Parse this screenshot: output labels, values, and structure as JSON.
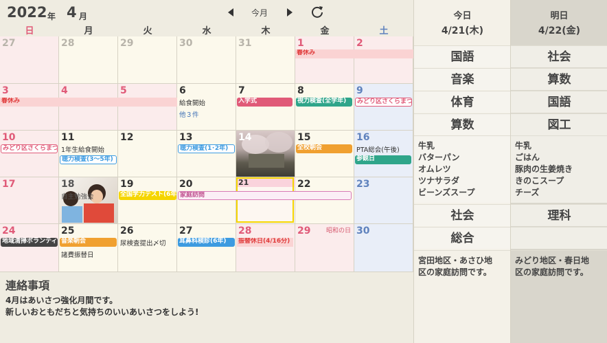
{
  "header": {
    "year": "2022",
    "year_unit": "年",
    "month": "4",
    "month_unit": "月",
    "today_button": "今月",
    "weekdays": [
      "日",
      "月",
      "火",
      "水",
      "木",
      "金",
      "土"
    ]
  },
  "days": {
    "r0": [
      "27",
      "28",
      "29",
      "30",
      "31",
      "1",
      "2"
    ],
    "r1": [
      "3",
      "4",
      "5",
      "6",
      "7",
      "8",
      "9"
    ],
    "r2": [
      "10",
      "11",
      "12",
      "13",
      "14",
      "15",
      "16"
    ],
    "r3": [
      "17",
      "18",
      "19",
      "20",
      "21",
      "22",
      "23"
    ],
    "r4": [
      "24",
      "25",
      "26",
      "27",
      "28",
      "29",
      "30"
    ]
  },
  "events": {
    "haruyasumi_1": "春休み",
    "haruyasumi_2": "春休み",
    "kyushoku_start": "給食開始",
    "more_count": "他３件",
    "nyugakushiki": "入学式",
    "shiryoku": "視力検査(全学年)",
    "midori_1": "みどり区さくらまつり",
    "midori_2": "みどり区さくらまつり",
    "kyushoku_1nen": "1年生給食開始",
    "choryoku_1": "聴力検査(3〜5年)",
    "choryoku_2": "聴力検査(1･2年)",
    "zenko_chokai": "全校朝会",
    "pta": "PTA総会(午後)",
    "sankanbi": "参観日",
    "jishu_kyugyo": "自主勉強会",
    "zenkoku_test": "全国学力テスト(6年)",
    "katei_homon": "家庭訪問",
    "chiiki_seiso": "地域清掃ボランティア",
    "ongaku_chokai": "音楽朝会",
    "shohi_furikae": "諸費振替日",
    "nyo_kensa": "尿検査提出〆切",
    "jibika": "耳鼻科検診(6年)",
    "furikae_kyujitsu": "振替休日(4/16分)",
    "showa_no_hi": "昭和の日"
  },
  "notes": {
    "title": "連絡事項",
    "line1": "4月はあいさつ強化月間です。",
    "line2": "新しいおともだちと気持ちのいいあいさつをしよう!"
  },
  "today": {
    "label": "今日",
    "date": "4/21(木)",
    "subjects1": [
      "国語",
      "音楽",
      "体育",
      "算数"
    ],
    "lunch": [
      "牛乳",
      "バターパン",
      "オムレツ",
      "ツナサラダ",
      "ビーンズスープ"
    ],
    "subjects2": [
      "社会",
      "総合"
    ],
    "notice_line1": "宮田地区・あさひ地",
    "notice_line2": "区の家庭訪問です。"
  },
  "tomorrow": {
    "label": "明日",
    "date": "4/22(金)",
    "subjects1": [
      "社会",
      "算数",
      "国語",
      "図工"
    ],
    "lunch": [
      "牛乳",
      "ごはん",
      "豚肉の生姜焼き",
      "きのこスープ",
      "チーズ"
    ],
    "subjects2": [
      "理科",
      ""
    ],
    "notice_line1": "みどり地区・春日地",
    "notice_line2": "区の家庭訪問です。"
  },
  "colors": {
    "sunday": "#e05a78",
    "saturday": "#5f82bd",
    "event_red": "#e05a78",
    "event_blue": "#3d9be0",
    "event_orange": "#f0a030",
    "event_yellow": "#f5d500",
    "event_teal": "#2fa58a",
    "event_dark": "#444444",
    "today_outline": "#f5d500"
  }
}
